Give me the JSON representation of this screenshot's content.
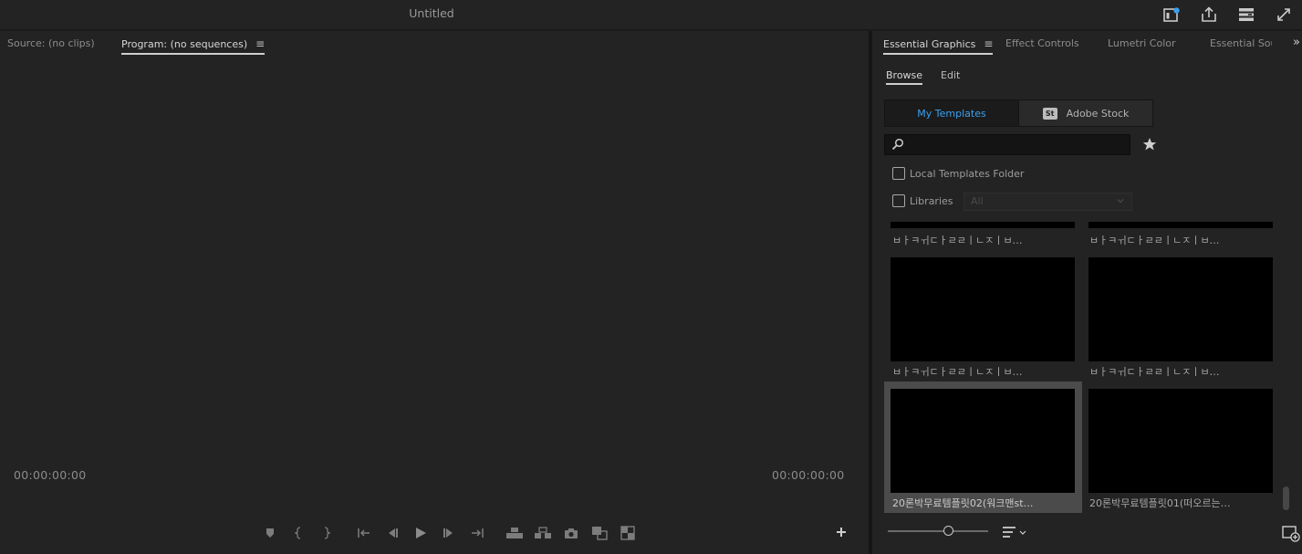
{
  "app": {
    "title": "Untitled"
  },
  "titlebar_icons": [
    "quick-export-panel-icon",
    "export-icon",
    "workspace-menu-icon",
    "fullscreen-icon"
  ],
  "monitor": {
    "source_tab": "Source: (no clips)",
    "program_tab": "Program: (no sequences)",
    "menu_glyph": "≡",
    "timecode_left": "00:00:00:00",
    "timecode_right": "00:00:00:00",
    "transport_controls": [
      "add-marker",
      "mark-in",
      "mark-out",
      "go-to-in",
      "step-back",
      "play",
      "step-forward",
      "go-to-out",
      "lift",
      "extract",
      "export-frame",
      "comparison-view",
      "multi-camera"
    ]
  },
  "panel": {
    "tabs": [
      "Essential Graphics",
      "Effect Controls",
      "Lumetri Color",
      "Essential Soun"
    ],
    "menu_glyph": "≡",
    "more_glyph": "»",
    "subtabs": [
      "Browse",
      "Edit"
    ],
    "segments": {
      "my_templates": "My Templates",
      "adobe_stock": "Adobe Stock",
      "stock_badge": "St"
    },
    "search": {
      "value": "",
      "placeholder": ""
    },
    "checkbox_local": "Local Templates Folder",
    "checkbox_libraries": "Libraries",
    "libraries_dropdown": "All",
    "templates": [
      {
        "label": "ㅂㅏㅋㅟㄷㅏㄹㄹㅣㄴㅈㅣㅂ…",
        "selected": false
      },
      {
        "label": "ㅂㅏㅋㅟㄷㅏㄹㄹㅣㄴㅈㅣㅂ…",
        "selected": false
      },
      {
        "label": "ㅂㅏㅋㅟㄷㅏㄹㄹㅣㄴㅈㅣㅂ…",
        "selected": false
      },
      {
        "label": "ㅂㅏㅋㅟㄷㅏㄹㄹㅣㄴㅈㅣㅂ…",
        "selected": false
      },
      {
        "label": "20론박무료템플릿02(워크맨st…",
        "selected": true
      },
      {
        "label": "20론박무료템플릿01(떠오르는…",
        "selected": false
      }
    ],
    "accent_color": "#3aa0ef"
  }
}
